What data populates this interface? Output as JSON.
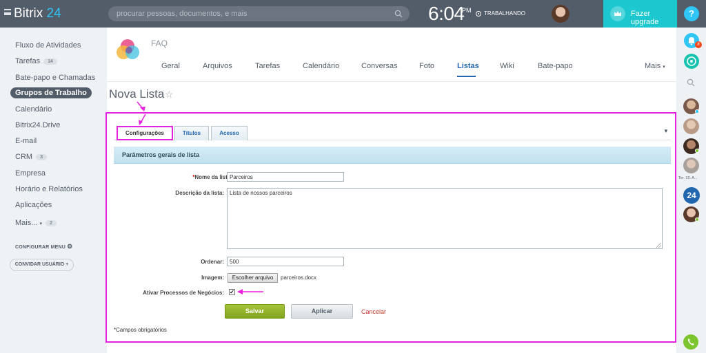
{
  "app": {
    "logo_text": "Bitrix",
    "logo_num": "24"
  },
  "search": {
    "placeholder": "procurar pessoas, documentos, e mais"
  },
  "clock": {
    "time": "6:04",
    "ampm": "PM",
    "status": "TRABALHANDO"
  },
  "upgrade": {
    "label": "Fazer upgrade"
  },
  "help": {
    "label": "?"
  },
  "leftmenu": {
    "items": [
      {
        "label": "Fluxo de Atividades"
      },
      {
        "label": "Tarefas",
        "badge": "14"
      },
      {
        "label": "Bate-papo e Chamadas"
      },
      {
        "label": "Grupos de Trabalho",
        "active": true
      },
      {
        "label": "Calendário"
      },
      {
        "label": "Bitrix24.Drive"
      },
      {
        "label": "E-mail"
      },
      {
        "label": "CRM",
        "badge": "3"
      },
      {
        "label": "Empresa"
      },
      {
        "label": "Horário e Relatórios"
      },
      {
        "label": "Aplicações"
      },
      {
        "label": "Mais...",
        "badge": "2"
      }
    ],
    "configure": "CONFIGURAR MENU",
    "invite": "CONVIDAR USUÁRIO"
  },
  "group": {
    "name": "FAQ",
    "tabs": [
      {
        "label": "Geral"
      },
      {
        "label": "Arquivos"
      },
      {
        "label": "Tarefas"
      },
      {
        "label": "Calendário"
      },
      {
        "label": "Conversas"
      },
      {
        "label": "Foto"
      },
      {
        "label": "Listas",
        "active": true
      },
      {
        "label": "Wiki"
      },
      {
        "label": "Bate-papo"
      },
      {
        "label": "Mais"
      }
    ]
  },
  "page": {
    "title": "Nova Lista",
    "star": "☆"
  },
  "form": {
    "tabs": [
      {
        "label": "Configurações",
        "active": true
      },
      {
        "label": "Títulos"
      },
      {
        "label": "Acesso"
      }
    ],
    "section_title": "Parâmetros gerais de lista",
    "fields": {
      "name_label": "Nome da lista:",
      "name_value": "Parceiros",
      "description_label": "Descrição da lista:",
      "description_value": "Lista de nossos parceiros",
      "order_label": "Ordenar:",
      "order_value": "500",
      "image_label": "Imagem:",
      "file_button": "Escolher arquivo",
      "file_name": "parceiros.docx",
      "bp_label": "Ativar Processos de Negócios:",
      "bp_checked": true
    },
    "buttons": {
      "save": "Salvar",
      "apply": "Aplicar",
      "cancel": "Cancelar"
    },
    "required_note": "*Campos obrigatórios"
  },
  "rightbar": {
    "notif_count": "8",
    "recent_label": "Ter. 15. A...",
    "b24_label": "24"
  },
  "colors": {
    "topbar": "#535c69",
    "accent_blue": "#2067b0",
    "upgrade": "#1cc7d0",
    "annotation": "#e522e0",
    "save_green": "#8eb02a"
  }
}
